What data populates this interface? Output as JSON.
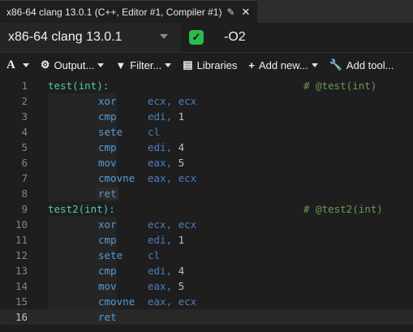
{
  "tab": {
    "title": "x86-64 clang 13.0.1 (C++, Editor #1, Compiler #1)",
    "pencil_icon": "✎",
    "close_icon": "✕"
  },
  "compiler": {
    "name": "x86-64 clang 13.0.1",
    "status_icon": "✓",
    "options": "-O2"
  },
  "toolbar": {
    "font_label": "A",
    "output_label": "Output...",
    "filter_label": "Filter...",
    "libraries_label": "Libraries",
    "add_new_label": "Add new...",
    "add_tool_label": "Add tool..."
  },
  "code": {
    "lines": [
      {
        "n": "1",
        "label": "test(int):",
        "comment": "# @test(int)"
      },
      {
        "n": "2",
        "mn": "xor",
        "ops": "ecx, ecx"
      },
      {
        "n": "3",
        "mn": "cmp",
        "ops": "edi, ",
        "num": "1"
      },
      {
        "n": "4",
        "mn": "sete",
        "ops": "cl"
      },
      {
        "n": "5",
        "mn": "cmp",
        "ops": "edi, ",
        "num": "4"
      },
      {
        "n": "6",
        "mn": "mov",
        "ops": "eax, ",
        "num": "5"
      },
      {
        "n": "7",
        "mn": "cmovne",
        "ops": "eax, ecx"
      },
      {
        "n": "8",
        "mn": "ret",
        "ops": ""
      },
      {
        "n": "9",
        "label": "test2(int):",
        "comment": "# @test2(int)"
      },
      {
        "n": "10",
        "mn": "xor",
        "ops": "ecx, ecx"
      },
      {
        "n": "11",
        "mn": "cmp",
        "ops": "edi, ",
        "num": "1"
      },
      {
        "n": "12",
        "mn": "sete",
        "ops": "cl"
      },
      {
        "n": "13",
        "mn": "cmp",
        "ops": "edi, ",
        "num": "4"
      },
      {
        "n": "14",
        "mn": "mov",
        "ops": "eax, ",
        "num": "5"
      },
      {
        "n": "15",
        "mn": "cmovne",
        "ops": "eax, ecx"
      },
      {
        "n": "16",
        "mn": "ret",
        "ops": ""
      }
    ],
    "current_line": "16"
  }
}
